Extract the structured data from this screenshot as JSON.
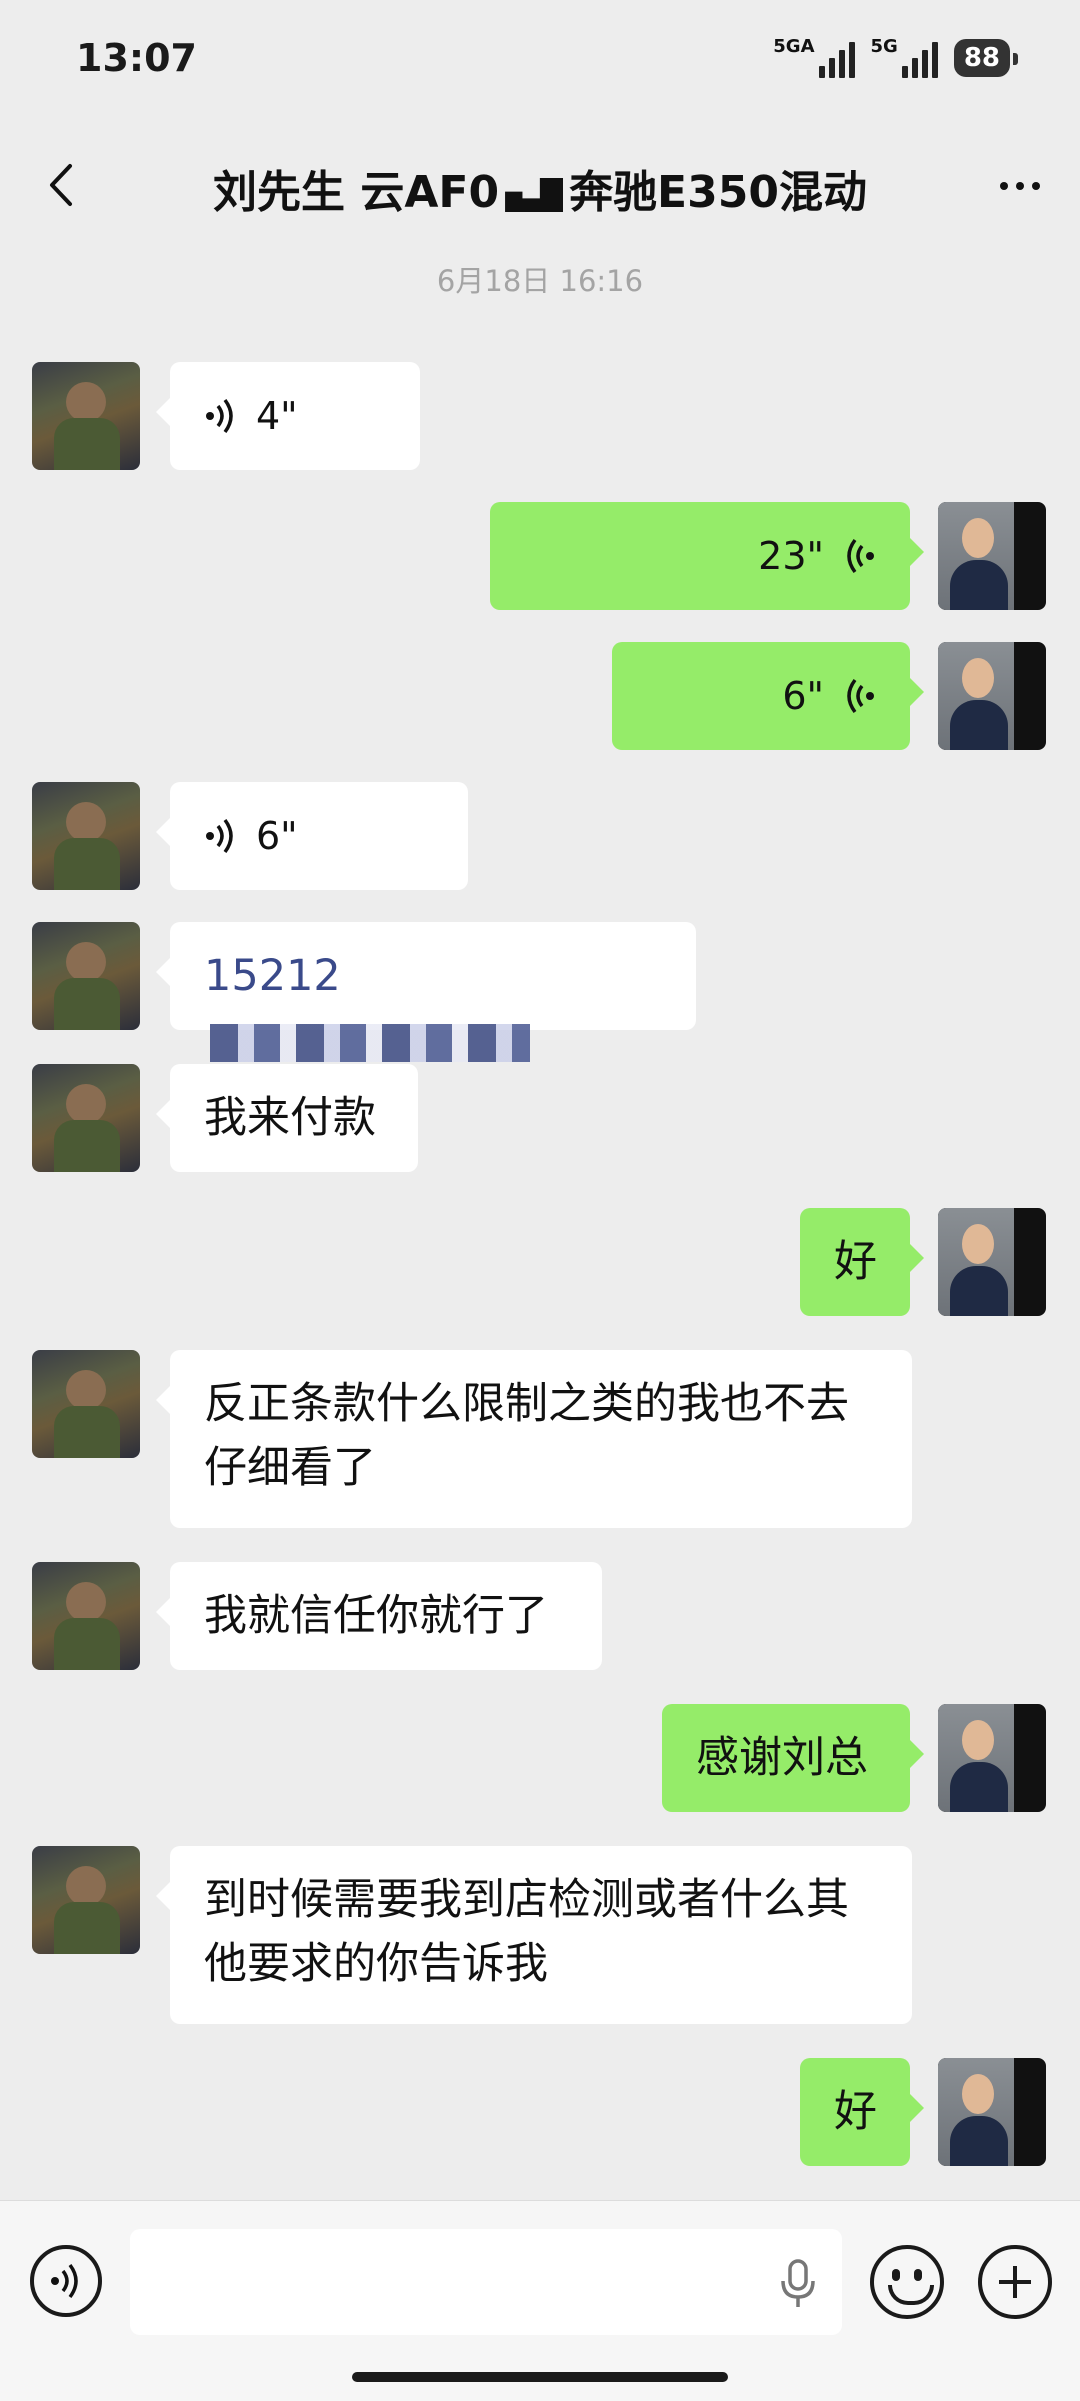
{
  "status_bar": {
    "time": "13:07",
    "net1": "5GA",
    "net2": "5G",
    "battery": "88"
  },
  "nav": {
    "title_part1": "刘先生 云AF0",
    "title_part2": "奔驰E350混动"
  },
  "chat": {
    "timestamp": "6月18日 16:16",
    "messages": [
      {
        "from": "customer",
        "type": "voice",
        "duration": "4\""
      },
      {
        "from": "me",
        "type": "voice",
        "duration": "23\""
      },
      {
        "from": "me",
        "type": "voice",
        "duration": "6\""
      },
      {
        "from": "customer",
        "type": "voice",
        "duration": "6\""
      },
      {
        "from": "customer",
        "type": "text",
        "text": "15212"
      },
      {
        "from": "customer",
        "type": "text",
        "text": "我来付款"
      },
      {
        "from": "me",
        "type": "text",
        "text": "好"
      },
      {
        "from": "customer",
        "type": "text",
        "text_line1": "反正条款什么限制之类的我也不去",
        "text_line2": "仔细看了"
      },
      {
        "from": "customer",
        "type": "text",
        "text": "我就信任你就行了"
      },
      {
        "from": "me",
        "type": "text",
        "text": "感谢刘总"
      },
      {
        "from": "customer",
        "type": "text",
        "text_line1": "到时候需要我到店检测或者什么其",
        "text_line2": "他要求的你告诉我"
      },
      {
        "from": "me",
        "type": "text",
        "text": "好"
      }
    ]
  },
  "colors": {
    "outgoing_bubble": "#95ec69",
    "incoming_bubble": "#ffffff",
    "background": "#ededed"
  },
  "icons": [
    "back-arrow-icon",
    "more-dots-icon",
    "voice-wave-icon",
    "microphone-icon",
    "emoji-icon",
    "plus-icon"
  ]
}
